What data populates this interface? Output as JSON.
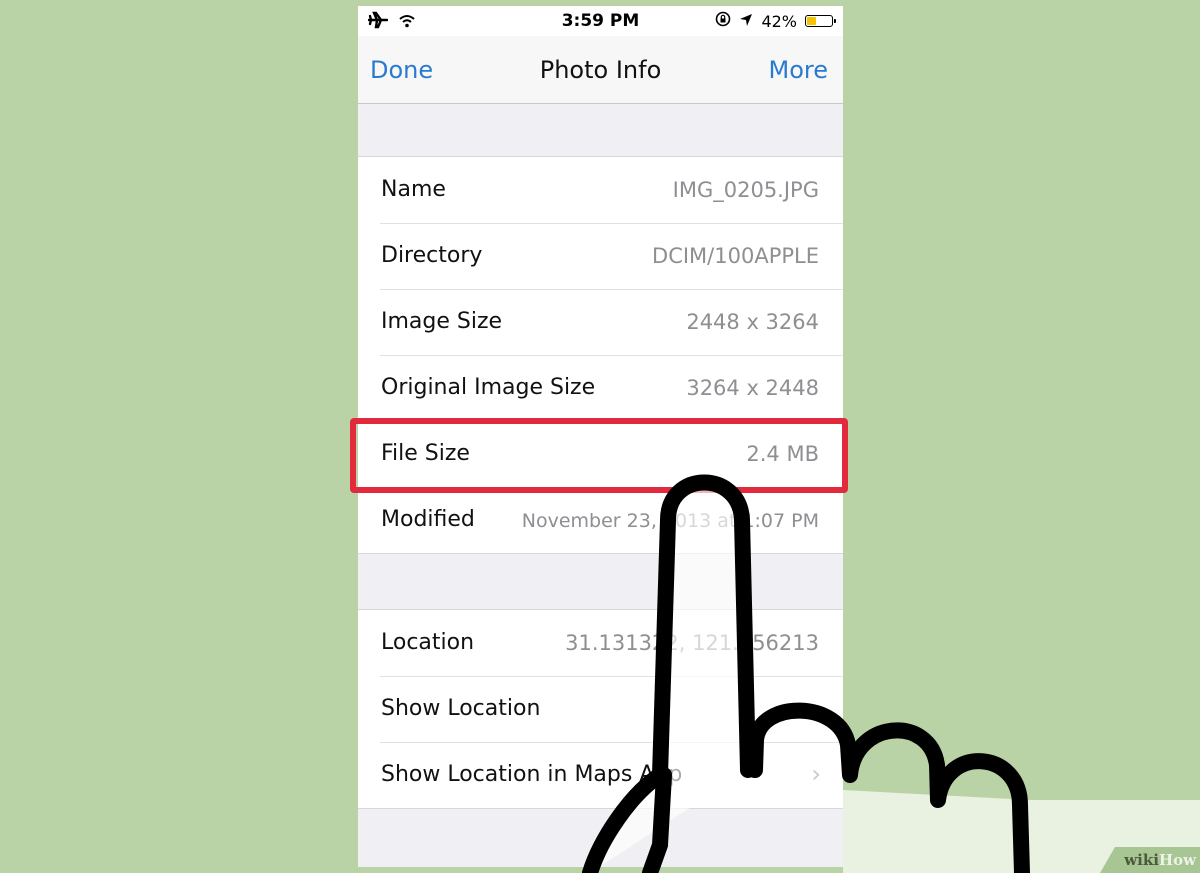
{
  "status_bar": {
    "time": "3:59 PM",
    "battery_percent_label": "42%",
    "battery_level": 0.42,
    "battery_color": "#f5c400",
    "icons": [
      "airplane-icon",
      "wifi-icon",
      "rotation-lock-icon",
      "location-arrow-icon",
      "battery-icon"
    ]
  },
  "nav": {
    "left_button": "Done",
    "title": "Photo Info",
    "right_button": "More",
    "accent_color": "#2a7ad0"
  },
  "file_info": [
    {
      "label": "Name",
      "value": "IMG_0205.JPG"
    },
    {
      "label": "Directory",
      "value": "DCIM/100APPLE"
    },
    {
      "label": "Image Size",
      "value": "2448 x 3264"
    },
    {
      "label": "Original Image Size",
      "value": "3264 x 2448"
    },
    {
      "label": "File Size",
      "value": "2.4 MB",
      "highlighted": true
    },
    {
      "label": "Modified",
      "value": "November 23, 2013 at 1:07 PM"
    }
  ],
  "location_info": [
    {
      "label": "Location",
      "value": "31.131322, 121.356213"
    },
    {
      "label": "Show Location",
      "value": ""
    },
    {
      "label": "Show Location in Maps App",
      "value": "",
      "chevron": "chevron-right-icon"
    }
  ],
  "highlight_color": "#e32a3d",
  "watermark": {
    "part1": "wiki",
    "part2": "How"
  }
}
